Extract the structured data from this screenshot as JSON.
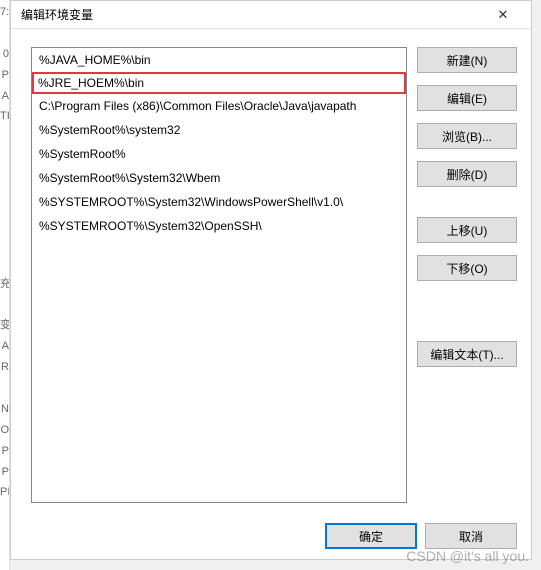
{
  "bg_chars": [
    "7:",
    "",
    "0",
    "P",
    "A",
    "TI",
    "",
    "",
    "",
    "",
    "",
    "",
    "",
    "充",
    "",
    "变",
    "A",
    "R",
    "",
    "N",
    "O",
    "P",
    "P",
    "PI"
  ],
  "dialog": {
    "title": "编辑环境变量",
    "close_label": "✕"
  },
  "list": {
    "items": [
      {
        "text": "%JAVA_HOME%\\bin",
        "highlighted": false
      },
      {
        "text": "%JRE_HOEM%\\bin",
        "highlighted": true
      },
      {
        "text": "C:\\Program Files (x86)\\Common Files\\Oracle\\Java\\javapath",
        "highlighted": false
      },
      {
        "text": "%SystemRoot%\\system32",
        "highlighted": false
      },
      {
        "text": "%SystemRoot%",
        "highlighted": false
      },
      {
        "text": "%SystemRoot%\\System32\\Wbem",
        "highlighted": false
      },
      {
        "text": "%SYSTEMROOT%\\System32\\WindowsPowerShell\\v1.0\\",
        "highlighted": false
      },
      {
        "text": "%SYSTEMROOT%\\System32\\OpenSSH\\",
        "highlighted": false
      }
    ]
  },
  "buttons": {
    "new": "新建(N)",
    "edit": "编辑(E)",
    "browse": "浏览(B)...",
    "delete": "删除(D)",
    "moveup": "上移(U)",
    "movedown": "下移(O)",
    "edittext": "编辑文本(T)...",
    "ok": "确定",
    "cancel": "取消"
  },
  "watermark": "CSDN @it's all you."
}
